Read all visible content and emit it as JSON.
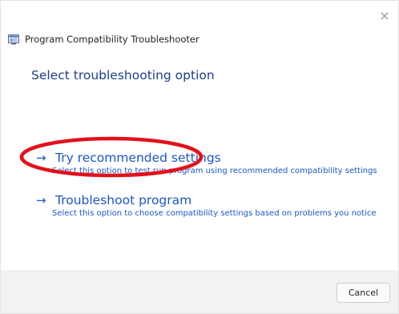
{
  "window": {
    "title": "Program Compatibility Troubleshooter",
    "close_glyph": "×",
    "icon": "troubleshooter-app-icon"
  },
  "main": {
    "heading": "Select troubleshooting option",
    "options": [
      {
        "arrow": "→",
        "title": "Try recommended settings",
        "description": "Select this option to test run program using recommended compatibility settings"
      },
      {
        "arrow": "→",
        "title": "Troubleshoot program",
        "description": "Select this option to choose compatibility settings based on problems you notice"
      }
    ]
  },
  "footer": {
    "cancel_label": "Cancel"
  },
  "annotation": {
    "shape": "ellipse",
    "color": "#e3101a"
  },
  "colors": {
    "link": "#1a56c9",
    "heading": "#1c3f8f",
    "footer_bg": "#f2f2f2"
  }
}
